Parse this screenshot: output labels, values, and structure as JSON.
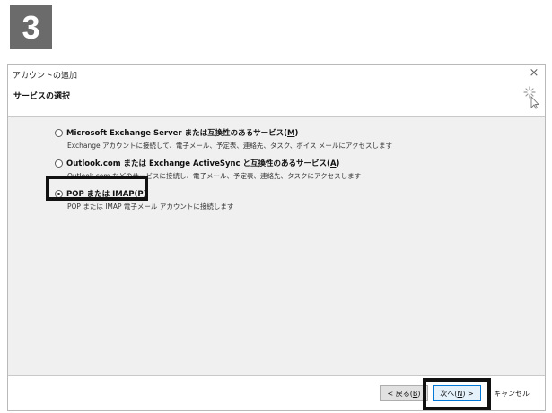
{
  "step_badge": "3",
  "window": {
    "title": "アカウントの追加",
    "close_glyph": "×"
  },
  "header": {
    "title": "サービスの選択"
  },
  "options": [
    {
      "label": "Microsoft Exchange Server または互換性のあるサービス(",
      "accel": "M",
      "label_end": ")",
      "description": "Exchange アカウントに接続して、電子メール、予定表、連絡先、タスク、ボイス メールにアクセスします",
      "selected": false
    },
    {
      "label": "Outlook.com または Exchange ActiveSync と互換性のあるサービス(",
      "accel": "A",
      "label_end": ")",
      "description": "Outlook.com などのサービスに接続し、電子メール、予定表、連絡先、タスクにアクセスします",
      "selected": false
    },
    {
      "label": "POP または IMAP(",
      "accel": "P",
      "label_end": ")",
      "description": "POP または IMAP 電子メール アカウントに接続します",
      "selected": true
    }
  ],
  "footer": {
    "back_label": "< 戻る(",
    "back_accel": "B",
    "back_end": ")",
    "next_label": "次へ(",
    "next_accel": "N",
    "next_end": ") >",
    "cancel_label": "キャンセル"
  },
  "colors": {
    "badge_bg": "#6b6b6b",
    "content_bg": "#f0f0f0",
    "highlight_border": "#111111",
    "default_button_border": "#0078d7"
  }
}
